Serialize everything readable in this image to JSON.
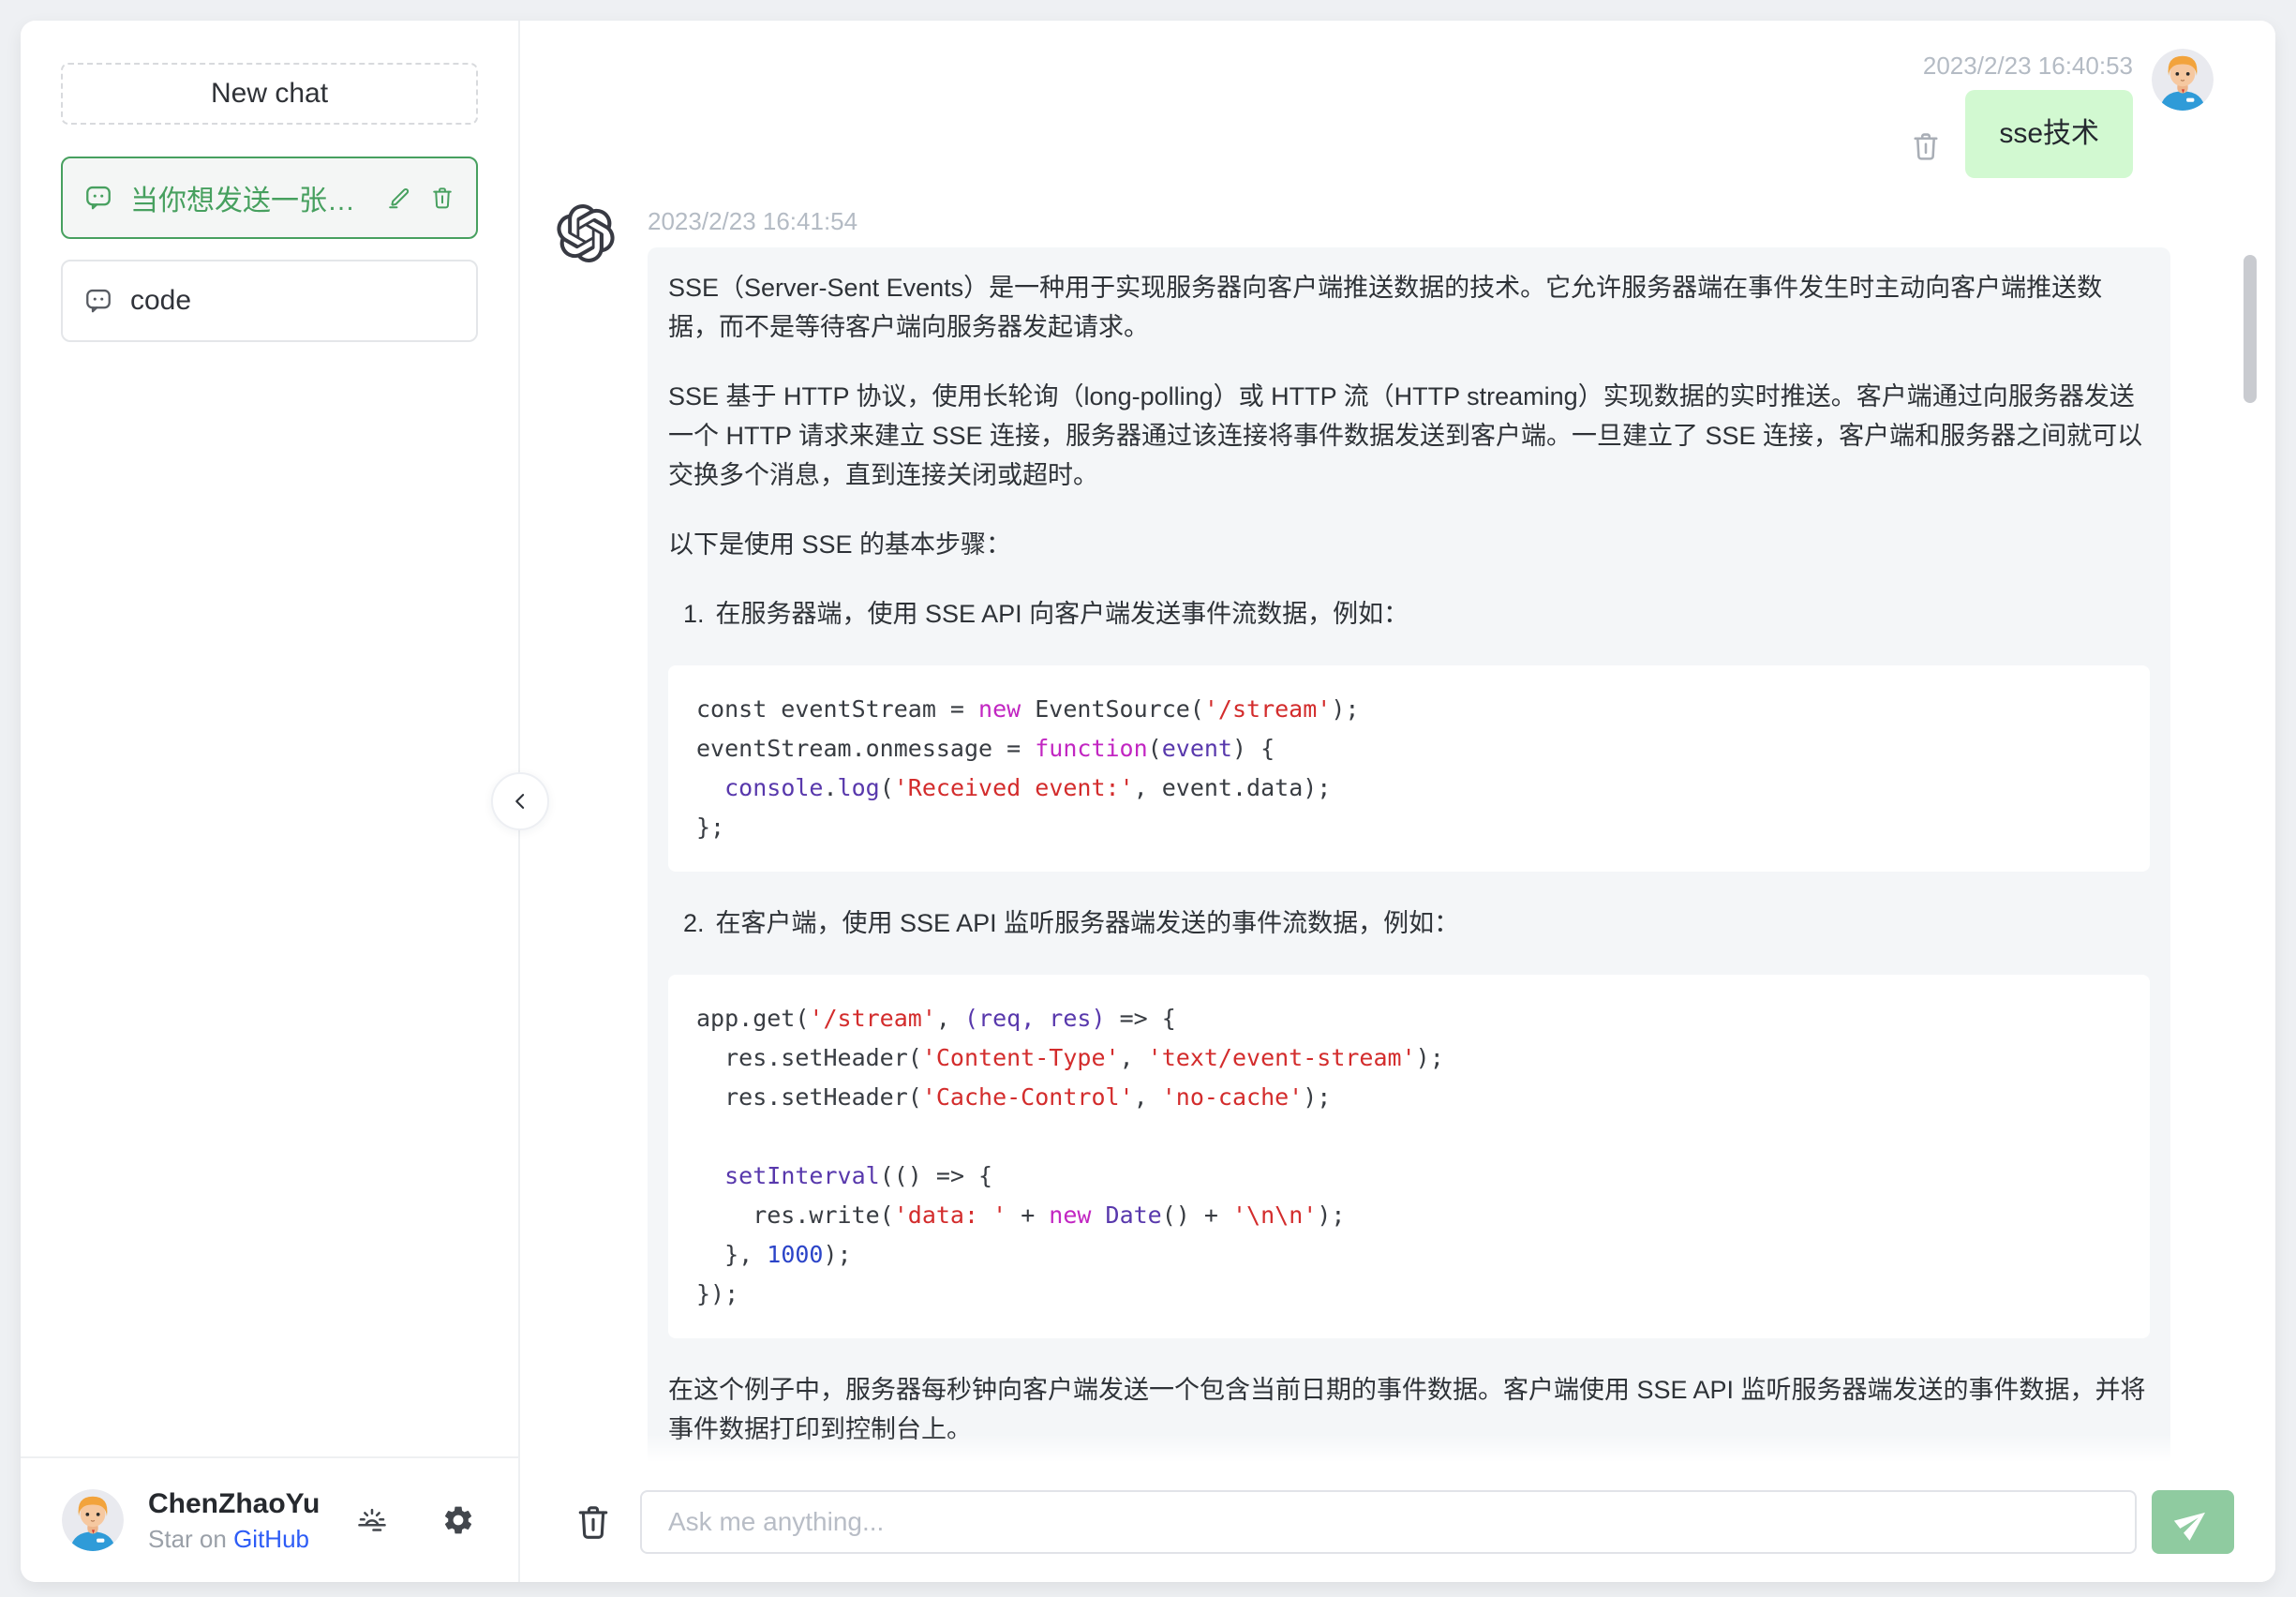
{
  "sidebar": {
    "new_chat_label": "New chat",
    "chats": [
      {
        "title": "当你想发送一张照...",
        "active": true
      },
      {
        "title": "code",
        "active": false
      }
    ],
    "footer": {
      "username": "ChenZhaoYu",
      "star_prefix": "Star on",
      "star_link": "GitHub"
    }
  },
  "main": {
    "user_message": {
      "timestamp": "2023/2/23 16:40:53",
      "text": "sse技术"
    },
    "assistant_message": {
      "timestamp": "2023/2/23 16:41:54",
      "p1": "SSE（Server-Sent Events）是一种用于实现服务器向客户端推送数据的技术。它允许服务器端在事件发生时主动向客户端推送数据，而不是等待客户端向服务器发起请求。",
      "p2": "SSE 基于 HTTP 协议，使用长轮询（long-polling）或 HTTP 流（HTTP streaming）实现数据的实时推送。客户端通过向服务器发送一个 HTTP 请求来建立 SSE 连接，服务器通过该连接将事件数据发送到客户端。一旦建立了 SSE 连接，客户端和服务器之间就可以交换多个消息，直到连接关闭或超时。",
      "p3": "以下是使用 SSE 的基本步骤：",
      "li1": {
        "num": "1.",
        "text": "在服务器端，使用 SSE API 向客户端发送事件流数据，例如："
      },
      "code1": [
        [
          {
            "t": "const eventStream = ",
            "c": "pl"
          },
          {
            "t": "new",
            "c": "kw"
          },
          {
            "t": " EventSource(",
            "c": "pl"
          },
          {
            "t": "'/stream'",
            "c": "str"
          },
          {
            "t": ");",
            "c": "pl"
          }
        ],
        [
          {
            "t": "eventStream.onmessage = ",
            "c": "pl"
          },
          {
            "t": "function",
            "c": "kw"
          },
          {
            "t": "(",
            "c": "pl"
          },
          {
            "t": "event",
            "c": "fn"
          },
          {
            "t": ") {",
            "c": "pl"
          }
        ],
        [
          {
            "t": "  ",
            "c": "pl"
          },
          {
            "t": "console",
            "c": "fn"
          },
          {
            "t": ".",
            "c": "pl"
          },
          {
            "t": "log",
            "c": "fn"
          },
          {
            "t": "(",
            "c": "pl"
          },
          {
            "t": "'Received event:'",
            "c": "str"
          },
          {
            "t": ", event.data);",
            "c": "pl"
          }
        ],
        [
          {
            "t": "};",
            "c": "pl"
          }
        ]
      ],
      "li2": {
        "num": "2.",
        "text": "在客户端，使用 SSE API 监听服务器端发送的事件流数据，例如："
      },
      "code2": [
        [
          {
            "t": "app.get(",
            "c": "pl"
          },
          {
            "t": "'/stream'",
            "c": "str"
          },
          {
            "t": ", ",
            "c": "pl"
          },
          {
            "t": "(req, res)",
            "c": "fn"
          },
          {
            "t": " => {",
            "c": "pl"
          }
        ],
        [
          {
            "t": "  res.setHeader(",
            "c": "pl"
          },
          {
            "t": "'Content-Type'",
            "c": "str"
          },
          {
            "t": ", ",
            "c": "pl"
          },
          {
            "t": "'text/event-stream'",
            "c": "str"
          },
          {
            "t": ");",
            "c": "pl"
          }
        ],
        [
          {
            "t": "  res.setHeader(",
            "c": "pl"
          },
          {
            "t": "'Cache-Control'",
            "c": "str"
          },
          {
            "t": ", ",
            "c": "pl"
          },
          {
            "t": "'no-cache'",
            "c": "str"
          },
          {
            "t": ");",
            "c": "pl"
          }
        ],
        [],
        [
          {
            "t": "  ",
            "c": "pl"
          },
          {
            "t": "setInterval",
            "c": "fn"
          },
          {
            "t": "(() => {",
            "c": "pl"
          }
        ],
        [
          {
            "t": "    res.write(",
            "c": "pl"
          },
          {
            "t": "'data: '",
            "c": "str"
          },
          {
            "t": " + ",
            "c": "pl"
          },
          {
            "t": "new",
            "c": "kw"
          },
          {
            "t": " ",
            "c": "pl"
          },
          {
            "t": "Date",
            "c": "fn"
          },
          {
            "t": "() + ",
            "c": "pl"
          },
          {
            "t": "'\\n\\n'",
            "c": "str"
          },
          {
            "t": ");",
            "c": "pl"
          }
        ],
        [
          {
            "t": "  }, ",
            "c": "pl"
          },
          {
            "t": "1000",
            "c": "num"
          },
          {
            "t": ");",
            "c": "pl"
          }
        ],
        [
          {
            "t": "});",
            "c": "pl"
          }
        ]
      ],
      "p4": "在这个例子中，服务器每秒钟向客户端发送一个包含当前日期的事件数据。客户端使用 SSE API 监听服务器端发送的事件数据，并将事件数据打印到控制台上。"
    }
  },
  "composer": {
    "placeholder": "Ask me anything..."
  },
  "icons": {
    "chat_item": "message-icon",
    "edit": "pencil-icon",
    "delete": "trash-icon",
    "theme": "sun-haze-icon",
    "settings": "gear-icon",
    "collapse": "chevron-left-icon",
    "send": "paper-plane-icon",
    "assistant": "openai-logo"
  },
  "colors": {
    "accent_green": "#47a05f",
    "user_bubble": "#d2f9d1",
    "assistant_bubble": "#f4f6f8",
    "link_blue": "#2d5cf6",
    "send_button": "#8fcba0",
    "timestamp": "#b4bbc4",
    "code_keyword": "#c226c2",
    "code_string": "#d32c2c",
    "code_builtin": "#5838ac",
    "code_number": "#2b44c8"
  }
}
